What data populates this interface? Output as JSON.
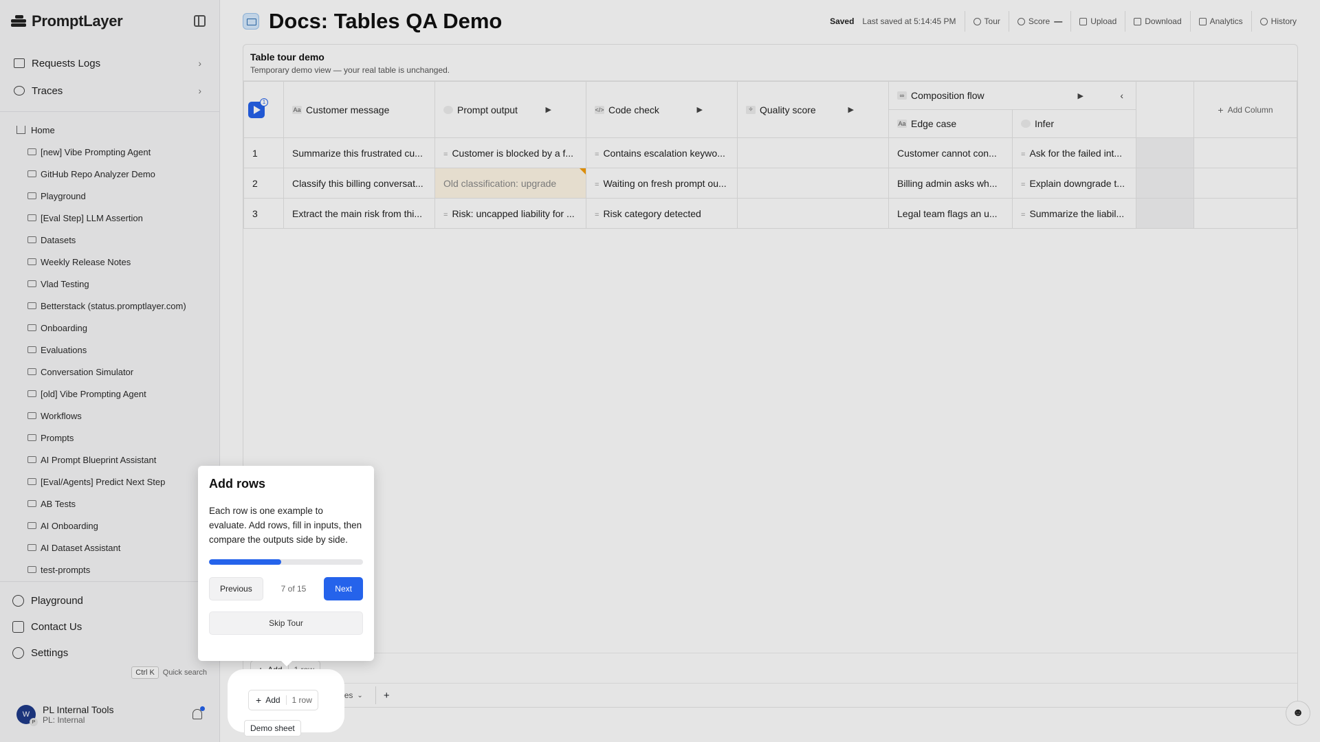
{
  "app": {
    "brand": "PromptLayer"
  },
  "sidebar": {
    "top_nav": [
      {
        "label": "Requests Logs"
      },
      {
        "label": "Traces"
      }
    ],
    "home": "Home",
    "folders": [
      "[new] Vibe Prompting Agent",
      "GitHub Repo Analyzer Demo",
      "Playground",
      "[Eval Step] LLM Assertion",
      "Datasets",
      "Weekly Release Notes",
      "Vlad Testing",
      "Betterstack (status.promptlayer.com)",
      "Onboarding",
      "Evaluations",
      "Conversation Simulator",
      "[old] Vibe Prompting Agent",
      "Workflows",
      "Prompts",
      "AI Prompt Blueprint Assistant",
      "[Eval/Agents] Predict Next Step",
      "AB Tests",
      "AI Onboarding",
      "AI Dataset Assistant",
      "test-prompts"
    ],
    "bottom_nav": [
      {
        "label": "Playground"
      },
      {
        "label": "Contact Us"
      },
      {
        "label": "Settings"
      }
    ],
    "quick_search": {
      "key": "Ctrl K",
      "label": "Quick search"
    },
    "profile": {
      "name": "PL Internal Tools",
      "org": "PL: Internal",
      "avatar": "W",
      "avatar_sub": "P"
    }
  },
  "header": {
    "title": "Docs: Tables QA Demo",
    "saved": "Saved",
    "last_saved": "Last saved at 5:14:45 PM",
    "buttons": [
      {
        "label": "Tour",
        "icon": "compass-icon"
      },
      {
        "label": "Score",
        "icon": "gauge-icon",
        "value": "—"
      },
      {
        "label": "Upload",
        "icon": "upload-icon"
      },
      {
        "label": "Download",
        "icon": "download-icon"
      },
      {
        "label": "Analytics",
        "icon": "analytics-icon"
      },
      {
        "label": "History",
        "icon": "history-icon"
      }
    ]
  },
  "sheet": {
    "title": "Table tour demo",
    "subtitle": "Temporary demo view — your real table is unchanged.",
    "run_badge": "1",
    "columns": {
      "customer_message": "Customer message",
      "prompt_output": "Prompt output",
      "code_check": "Code check",
      "quality_score": "Quality score",
      "composition_flow": "Composition flow",
      "edge_case": "Edge case",
      "infer": "Infer",
      "add_column": "Add Column"
    },
    "rows": [
      {
        "num": "1",
        "customer_message": "Summarize this frustrated cu...",
        "prompt_output": "Customer is blocked by a f...",
        "code_check": "Contains escalation keywo...",
        "quality_score": "",
        "edge_case": "Customer cannot con...",
        "infer": "Ask for the failed int..."
      },
      {
        "num": "2",
        "customer_message": "Classify this billing conversat...",
        "prompt_output": "Old classification: upgrade",
        "code_check": "Waiting on fresh prompt ou...",
        "quality_score": "",
        "edge_case": "Billing admin asks wh...",
        "infer": "Explain downgrade t..."
      },
      {
        "num": "3",
        "customer_message": "Extract the main risk from thi...",
        "prompt_output": "Risk: uncapped liability for ...",
        "code_check": "Risk category detected",
        "quality_score": "",
        "edge_case": "Legal team flags an u...",
        "infer": "Summarize the liabil..."
      }
    ],
    "add_row": {
      "label": "Add",
      "count": "1 row"
    },
    "tabs": [
      {
        "label": "Demo sheet"
      },
      {
        "label": "Edge cases"
      }
    ],
    "tab_add": "+"
  },
  "tour": {
    "title": "Add rows",
    "body": "Each row is one example to evaluate. Add rows, fill in inputs, then compare the outputs side by side.",
    "progress": 0.4667,
    "step": "7 of 15",
    "prev": "Previous",
    "next": "Next",
    "skip": "Skip Tour"
  },
  "colors": {
    "accent": "#2563eb",
    "stale_marker": "#f59e0b"
  }
}
